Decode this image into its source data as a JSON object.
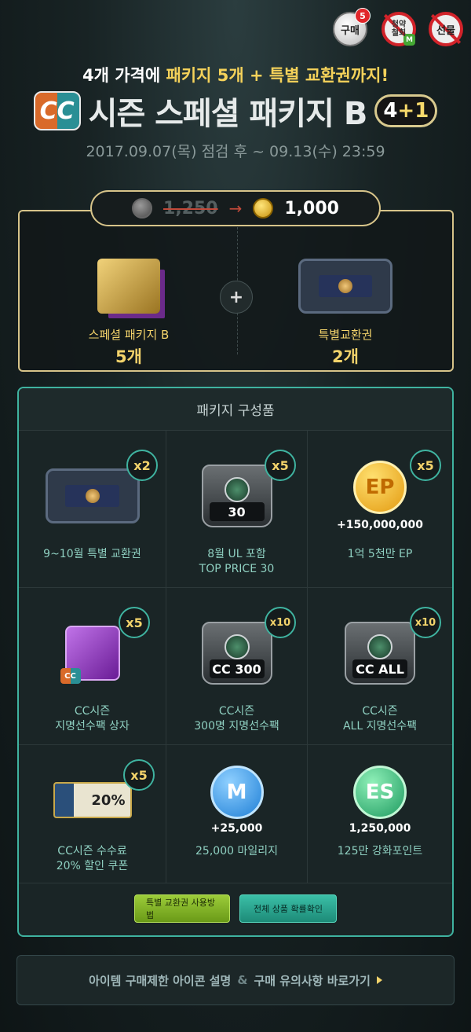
{
  "corner_buttons": {
    "buy_label": "구매",
    "buy_badge": "5",
    "cancel_label_line1": "청약",
    "cancel_label_line2": "철회",
    "cancel_badge": "M",
    "gift_label": "선물"
  },
  "header": {
    "subtitle_pre": "4개 가격에 ",
    "subtitle_hl": "패키지 5개 + 특별 교환권까지!",
    "logo": "CC",
    "title": "시즌 스페셜 패키지 B",
    "badge_main": "4",
    "badge_plus": "+1",
    "period": "2017.09.07(목) 점검 후 ~ 09.13(수) 23:59"
  },
  "price": {
    "old": "1,250",
    "new": "1,000"
  },
  "offer": {
    "plus": "+",
    "items": [
      {
        "name": "스페셜 패키지 B",
        "qty": "5개"
      },
      {
        "name": "특별교환권",
        "qty": "2개"
      }
    ]
  },
  "package": {
    "header": "패키지 구성품",
    "items": [
      {
        "count": "x2",
        "label1": "9~10월 특별 교환권",
        "label2": ""
      },
      {
        "count": "x5",
        "label1": "8월 UL 포함",
        "label2": "TOP PRICE 30",
        "art_text": "30",
        "art_sub": "TOP PRICE"
      },
      {
        "count": "x5",
        "label1": "1억 5천만 EP",
        "label2": "",
        "art_text": "EP",
        "value": "+150,000,000"
      },
      {
        "count": "x5",
        "label1": "CC시즌",
        "label2": "지명선수팩 상자",
        "art_text": "CC"
      },
      {
        "count": "x10",
        "label1": "CC시즌",
        "label2": "300명 지명선수팩",
        "art_text": "CC 300"
      },
      {
        "count": "x10",
        "label1": "CC시즌",
        "label2": "ALL 지명선수팩",
        "art_text": "CC ALL"
      },
      {
        "count": "x5",
        "label1": "CC시즌 수수료",
        "label2": "20% 할인 쿠폰",
        "art_text": "20%"
      },
      {
        "count": "",
        "label1": "25,000 마일리지",
        "label2": "",
        "art_text": "M",
        "value": "+25,000"
      },
      {
        "count": "",
        "label1": "125만 강화포인트",
        "label2": "",
        "art_text": "ES",
        "value": "1,250,000"
      }
    ],
    "btn_voucher": "특별 교환권 사용방법",
    "btn_prob": "전체 상품 확률확인"
  },
  "footer": {
    "text_a": "아이템 구매제한 아이콘 설명",
    "amp": "&",
    "text_b": "구매 유의사항 바로가기"
  }
}
